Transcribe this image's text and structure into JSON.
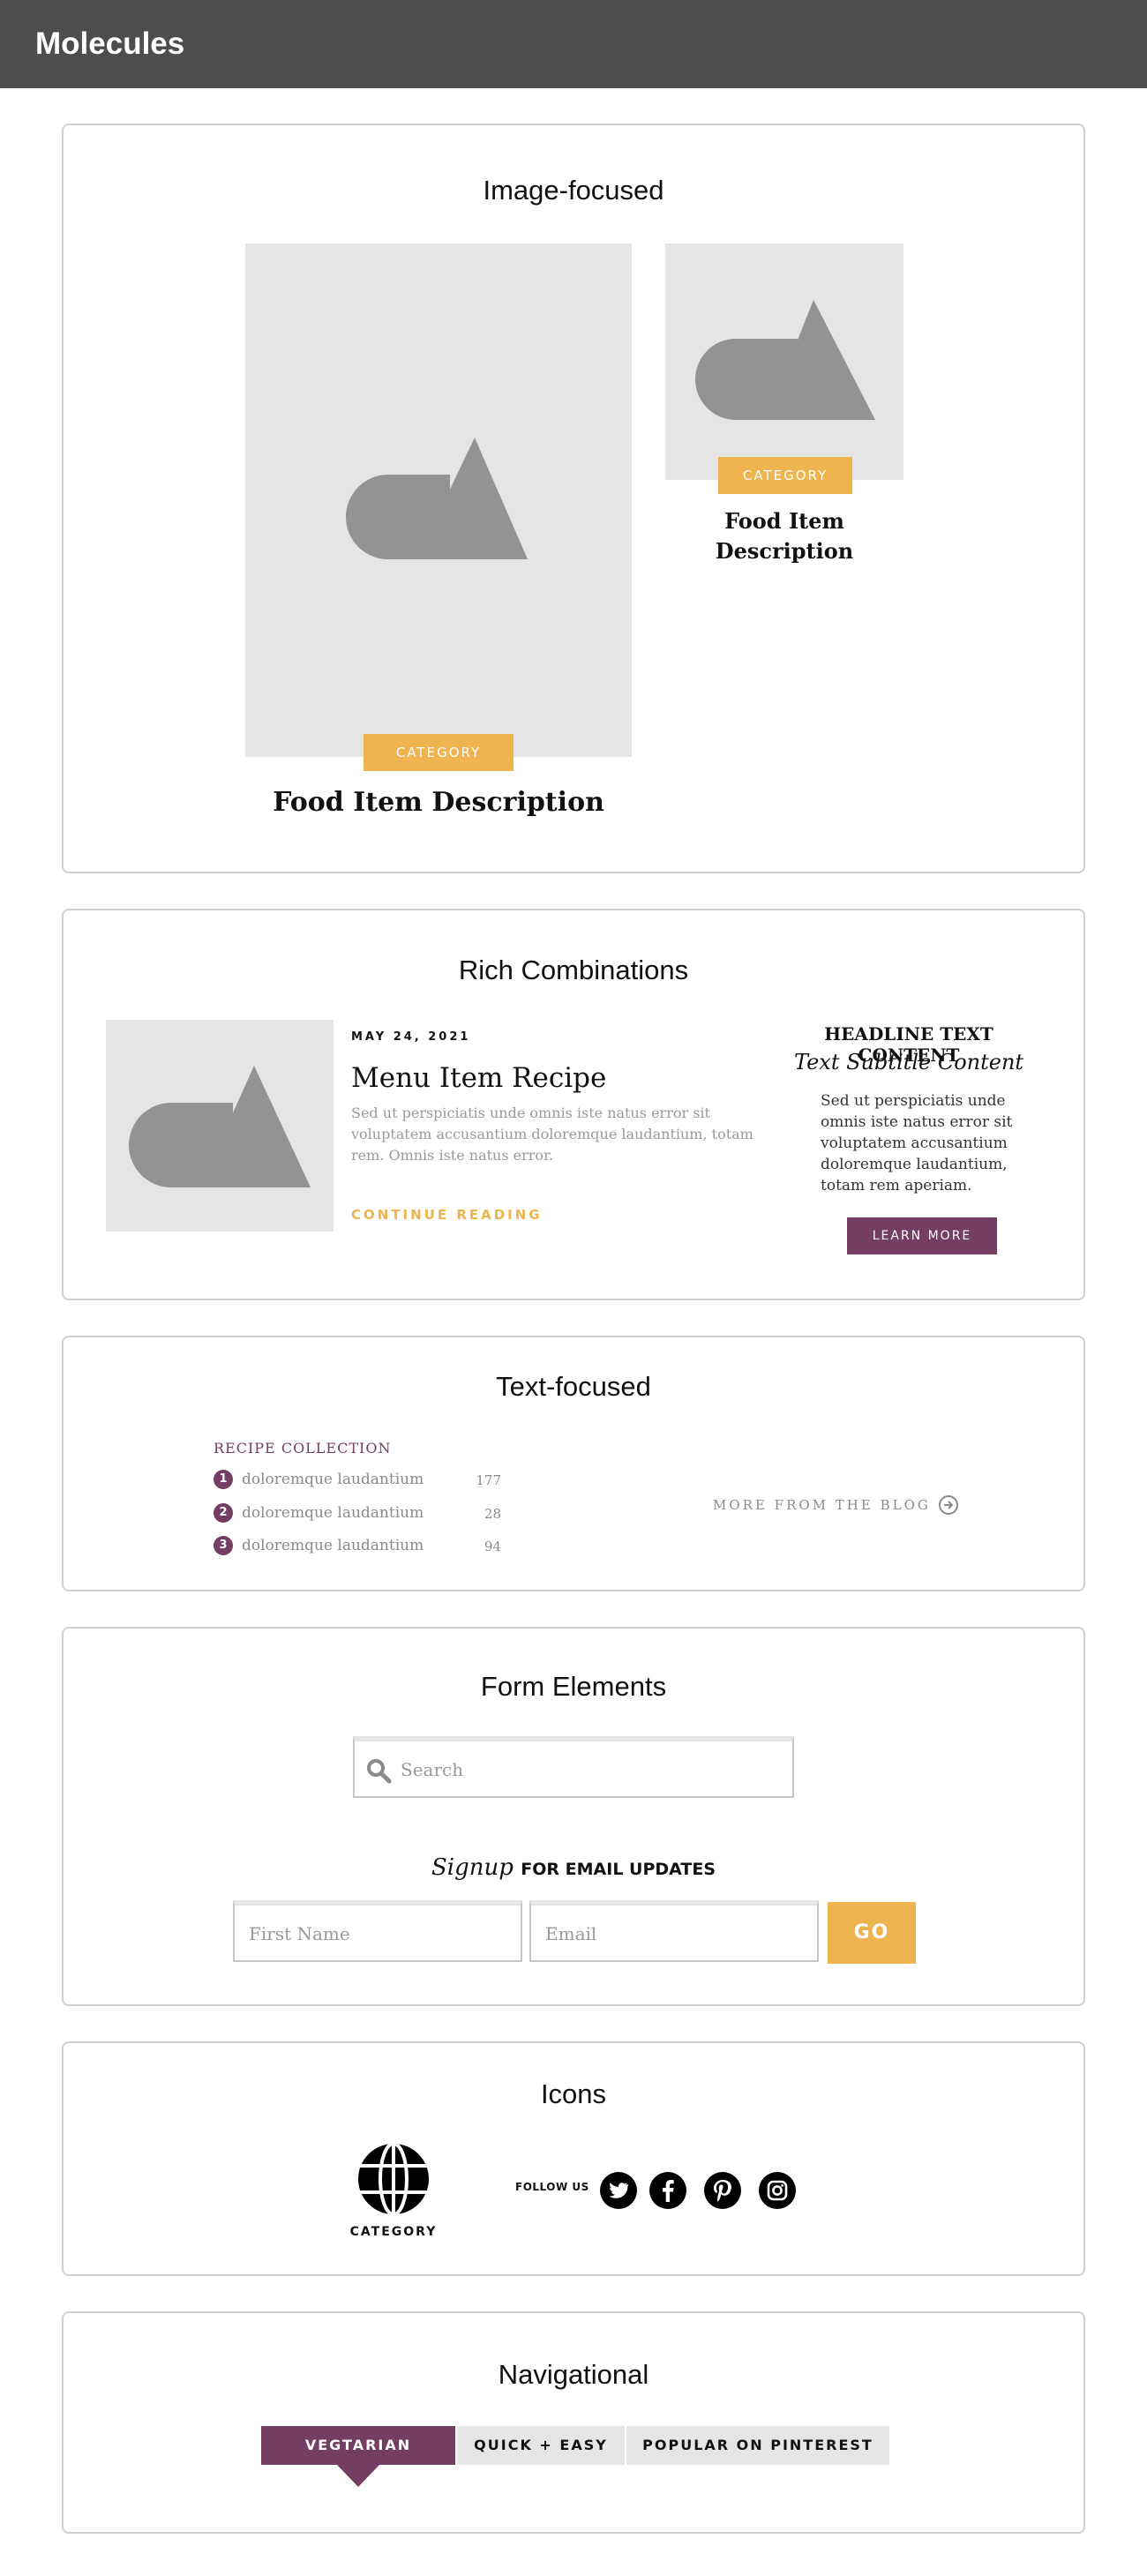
{
  "header": {
    "title": "Molecules"
  },
  "sections": {
    "image_focused": {
      "title": "Image-focused",
      "large_card": {
        "category": "CATEGORY",
        "title": "Food Item Description"
      },
      "small_card": {
        "category": "CATEGORY",
        "title_line1": "Food Item",
        "title_line2": "Description"
      }
    },
    "rich_combinations": {
      "title": "Rich Combinations",
      "post": {
        "date": "MAY 24, 2021",
        "title": "Menu Item Recipe",
        "excerpt_line1": "Sed ut perspiciatis unde omnis iste natus error sit",
        "excerpt_line2": "voluptatem accusantium doloremque laudantium, totam",
        "excerpt_line3": "rem. Omnis iste natus error.",
        "cta": "CONTINUE READING"
      },
      "promo": {
        "headline": "HEADLINE TEXT CONTENT",
        "subtitle": "Text Subtitle Content",
        "body_line1": "Sed ut perspiciatis unde",
        "body_line2": "omnis iste natus error sit",
        "body_line3": "voluptatem accusantium",
        "body_line4": "doloremque laudantium,",
        "body_line5": "totam rem aperiam.",
        "button": "LEARN MORE"
      }
    },
    "text_focused": {
      "title": "Text-focused",
      "collection_title": "RECIPE COLLECTION",
      "items": [
        {
          "num": "1",
          "label": "doloremque laudantium",
          "count": "177"
        },
        {
          "num": "2",
          "label": "doloremque laudantium",
          "count": "28"
        },
        {
          "num": "3",
          "label": "doloremque laudantium",
          "count": "94"
        }
      ],
      "blog_link": "MORE FROM THE BLOG"
    },
    "form_elements": {
      "title": "Form Elements",
      "search_placeholder": "Search",
      "signup_script": "Signup",
      "signup_text": "FOR EMAIL UPDATES",
      "first_name_placeholder": "First Name",
      "email_placeholder": "Email",
      "go_button": "GO"
    },
    "icons": {
      "title": "Icons",
      "category_label": "CATEGORY",
      "category_icon": "globe-icon",
      "follow_label": "FOLLOW US",
      "social_icons": [
        "twitter-icon",
        "facebook-icon",
        "pinterest-icon",
        "instagram-icon"
      ]
    },
    "navigational": {
      "title": "Navigational",
      "tabs": [
        {
          "label": "VEGTARIAN",
          "active": true
        },
        {
          "label": "QUICK + EASY",
          "active": false
        },
        {
          "label": "POPULAR ON PINTEREST",
          "active": false
        }
      ]
    }
  },
  "colors": {
    "header_bg": "#4d4d4d",
    "accent_gold": "#edb44f",
    "accent_purple": "#743d63",
    "placeholder_bg": "#e5e5e5",
    "placeholder_shape": "#939393"
  }
}
